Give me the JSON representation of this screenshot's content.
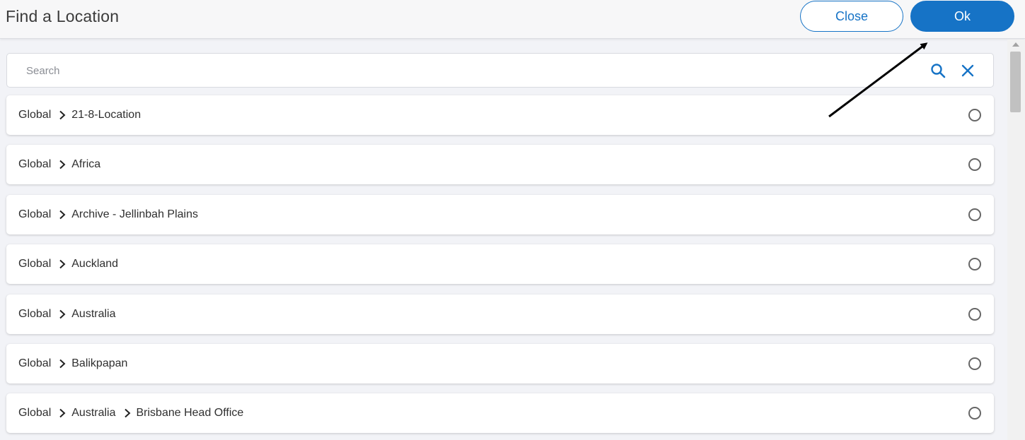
{
  "header": {
    "title": "Find a Location",
    "close_label": "Close",
    "ok_label": "Ok"
  },
  "search": {
    "placeholder": "Search",
    "value": ""
  },
  "locations": [
    {
      "path": [
        "Global",
        "21-8-Location"
      ]
    },
    {
      "path": [
        "Global",
        "Africa"
      ]
    },
    {
      "path": [
        "Global",
        "Archive - Jellinbah Plains"
      ]
    },
    {
      "path": [
        "Global",
        "Auckland"
      ]
    },
    {
      "path": [
        "Global",
        "Australia"
      ]
    },
    {
      "path": [
        "Global",
        "Balikpapan"
      ]
    },
    {
      "path": [
        "Global",
        "Australia",
        "Brisbane Head Office"
      ]
    }
  ],
  "icons": {
    "search": "search-icon",
    "clear": "close-icon",
    "separator": "chevron-right-icon",
    "radio": "radio-unselected-icon"
  },
  "colors": {
    "accent": "#1673c6",
    "page_bg": "#f2f3f7",
    "annotation_arrow": "#000000"
  }
}
